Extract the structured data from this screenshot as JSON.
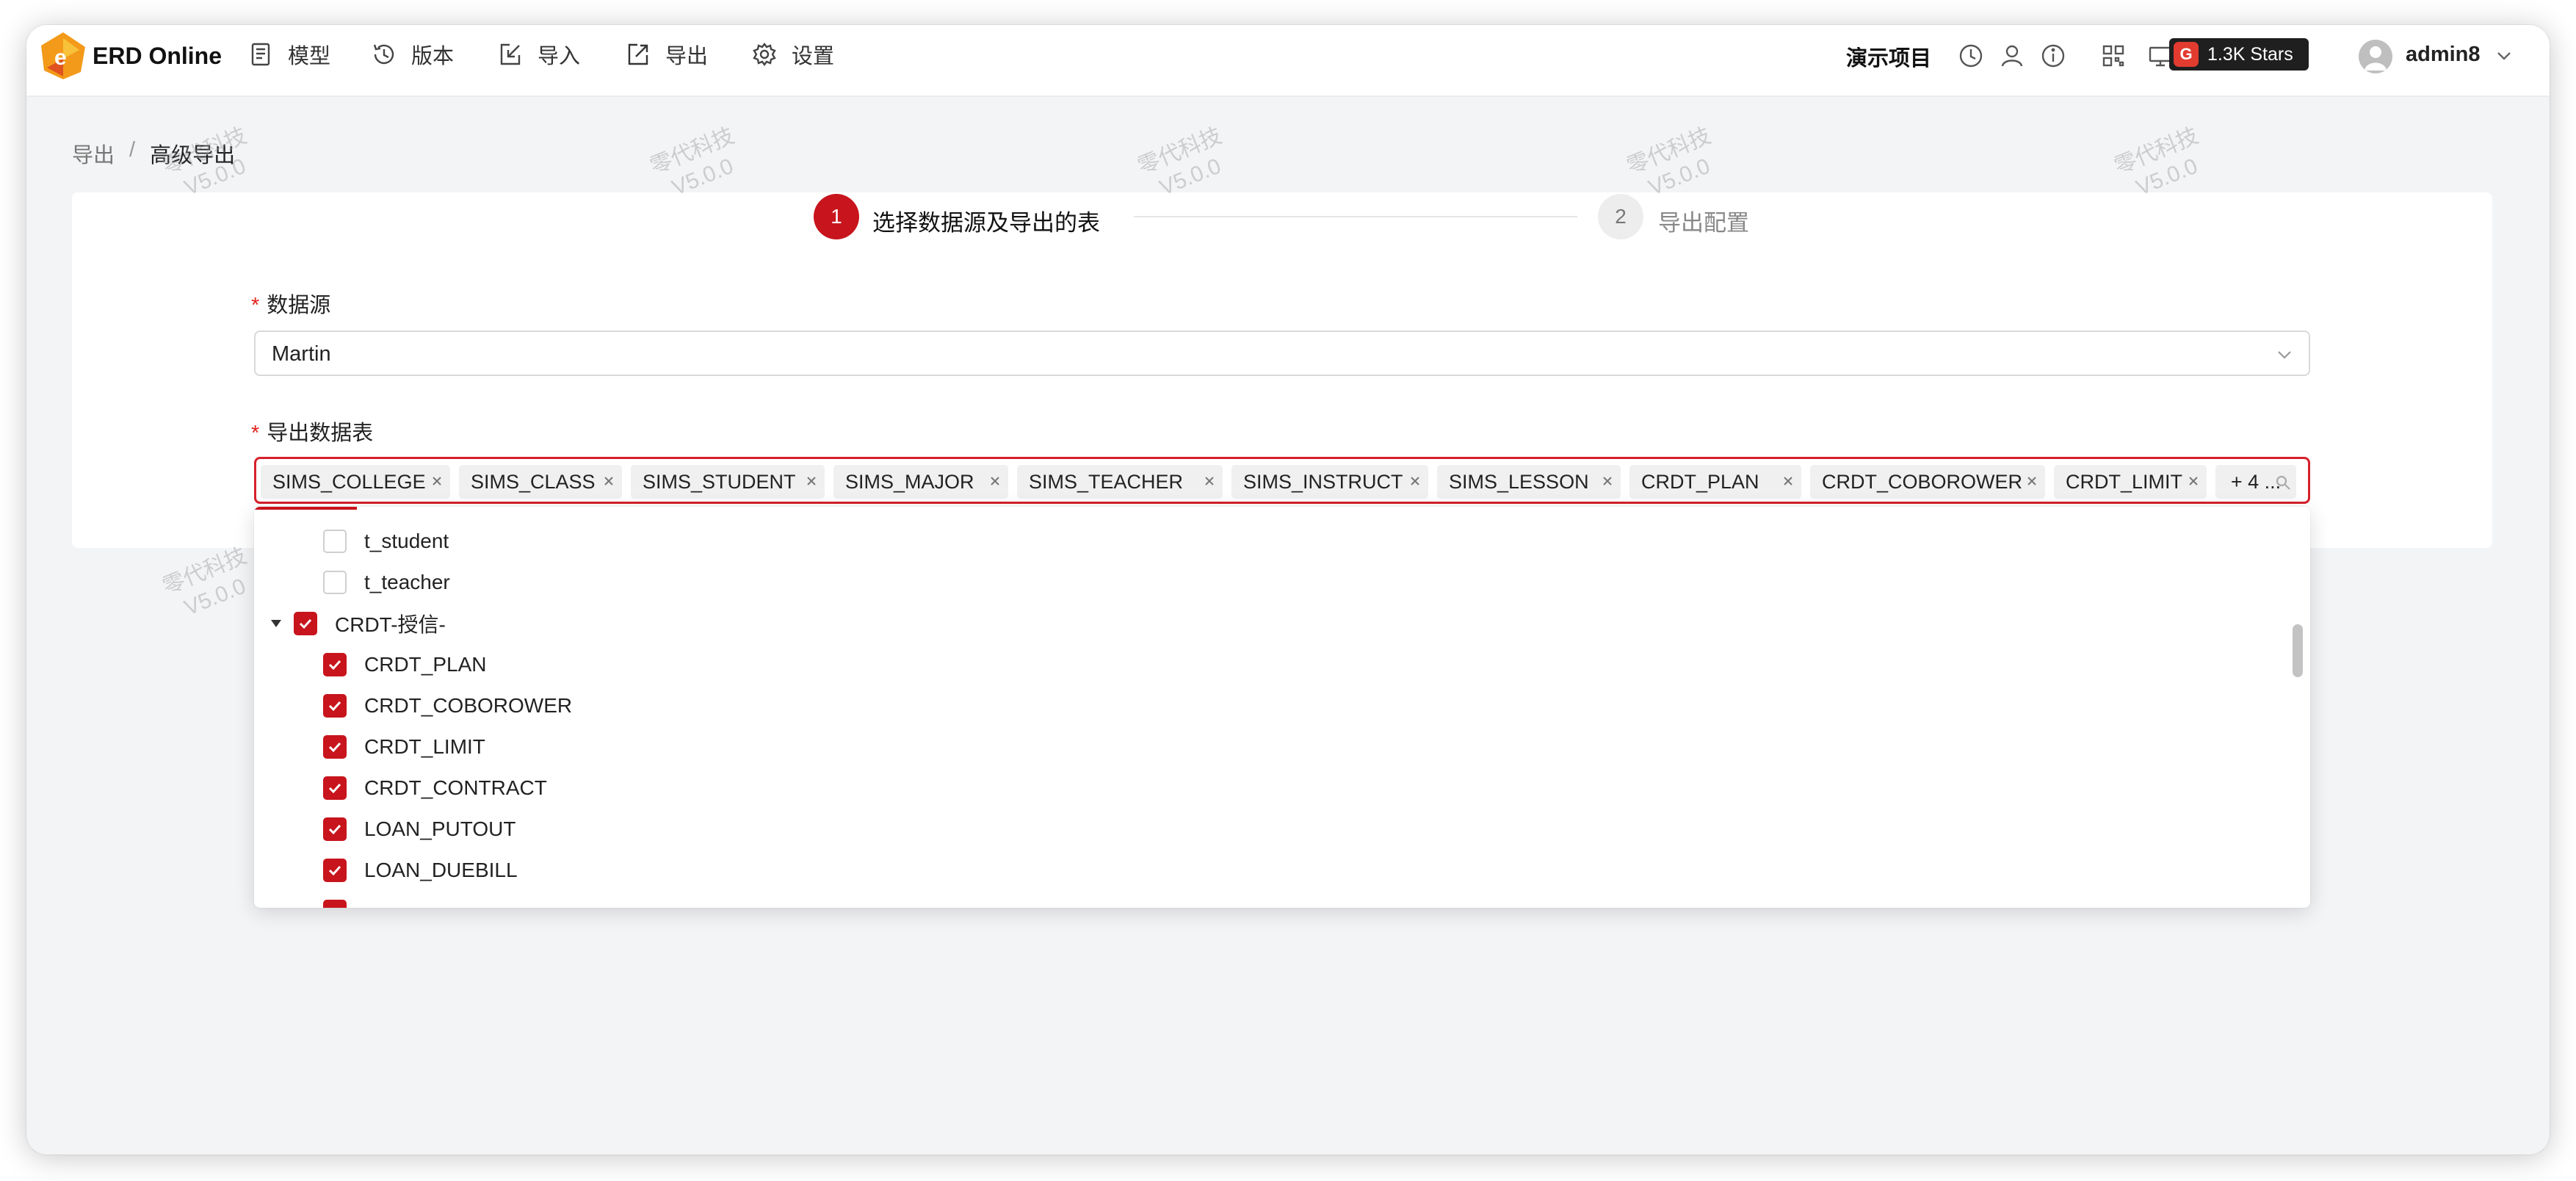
{
  "app": {
    "title": "ERD Online"
  },
  "nav": [
    {
      "label": "模型",
      "icon": "book-icon"
    },
    {
      "label": "版本",
      "icon": "history-icon"
    },
    {
      "label": "导入",
      "icon": "import-icon"
    },
    {
      "label": "导出",
      "icon": "export-icon"
    },
    {
      "label": "设置",
      "icon": "gear-icon"
    }
  ],
  "header": {
    "project": "演示项目",
    "stars": "1.3K Stars",
    "username": "admin8"
  },
  "breadcrumb": {
    "parent": "导出",
    "separator": "/",
    "current": "高级导出"
  },
  "steps": [
    {
      "number": "1",
      "title": "选择数据源及导出的表",
      "status": "active"
    },
    {
      "number": "2",
      "title": "导出配置",
      "status": "wait"
    }
  ],
  "form": {
    "datasource_label": "数据源",
    "datasource_value": "Martin",
    "tables_label": "导出数据表",
    "required_mark": "*",
    "selected_tags": [
      "SIMS_COLLEGE",
      "SIMS_CLASS",
      "SIMS_STUDENT",
      "SIMS_MAJOR",
      "SIMS_TEACHER",
      "SIMS_INSTRUCT",
      "SIMS_LESSON",
      "CRDT_PLAN",
      "CRDT_COBOROWER",
      "CRDT_LIMIT"
    ],
    "more_tag": "+ 4 ..."
  },
  "dropdown": {
    "items": [
      {
        "label": "t_student",
        "checked": false,
        "level": 2
      },
      {
        "label": "t_teacher",
        "checked": false,
        "level": 2
      },
      {
        "label": "CRDT-授信-",
        "checked": true,
        "level": 1,
        "expanded": true
      },
      {
        "label": "CRDT_PLAN",
        "checked": true,
        "level": 2
      },
      {
        "label": "CRDT_COBOROWER",
        "checked": true,
        "level": 2
      },
      {
        "label": "CRDT_LIMIT",
        "checked": true,
        "level": 2
      },
      {
        "label": "CRDT_CONTRACT",
        "checked": true,
        "level": 2
      },
      {
        "label": "LOAN_PUTOUT",
        "checked": true,
        "level": 2
      },
      {
        "label": "LOAN_DUEBILL",
        "checked": true,
        "level": 2
      }
    ]
  },
  "watermark": {
    "line1": "零代科技",
    "line2": "V5.0.0"
  },
  "colors": {
    "accent": "#c8141c",
    "brand_orange": "#f39a1a"
  }
}
